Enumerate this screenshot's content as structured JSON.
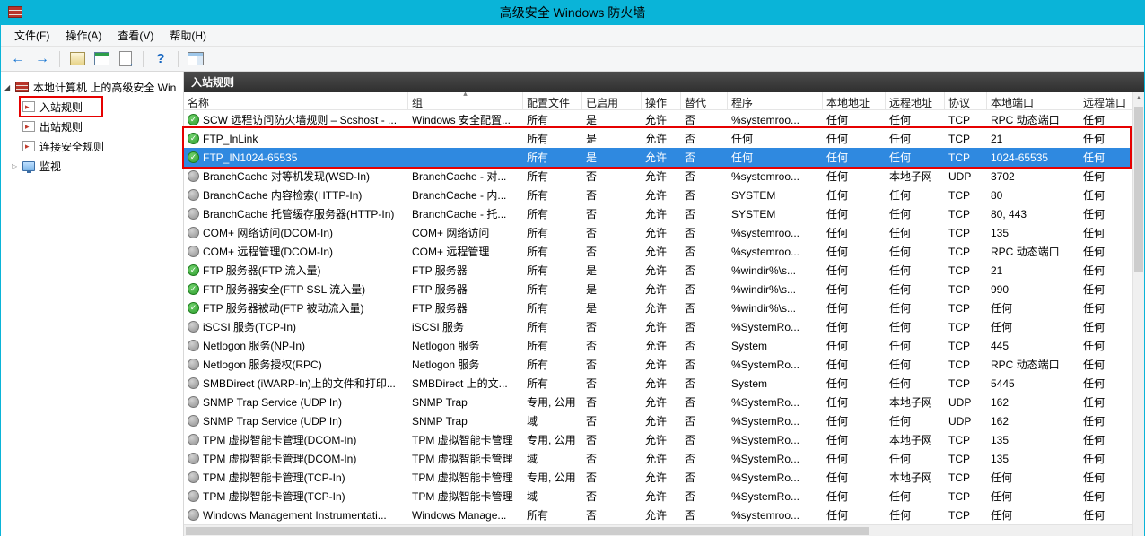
{
  "colors": {
    "titlebar": "#0ab4d8",
    "selection": "#2f89e0",
    "annotation": "#e60000",
    "panel_header_bg": "#3a3a3a",
    "enabled_icon": "#2e9e2e",
    "disabled_icon": "#8f8f8f"
  },
  "window": {
    "title": "高级安全 Windows 防火墙",
    "app_icon": "firewall-icon"
  },
  "menu": {
    "items": [
      {
        "id": "file",
        "label": "文件(F)"
      },
      {
        "id": "action",
        "label": "操作(A)"
      },
      {
        "id": "view",
        "label": "查看(V)"
      },
      {
        "id": "help",
        "label": "帮助(H)"
      }
    ]
  },
  "toolbar": {
    "icons": [
      "back-icon",
      "forward-icon",
      "show-console-tree-icon",
      "console-window-icon",
      "export-list-icon",
      "help-icon",
      "action-pane-icon"
    ]
  },
  "sidebar": {
    "root": {
      "label": "本地计算机 上的高级安全 Win",
      "icon": "firewall-root-icon"
    },
    "items": [
      {
        "id": "inbound-rules",
        "label": "入站规则",
        "icon": "inbound-rules-icon",
        "annotated": true
      },
      {
        "id": "outbound-rules",
        "label": "出站规则",
        "icon": "outbound-rules-icon"
      },
      {
        "id": "connection-security-rules",
        "label": "连接安全规则",
        "icon": "connection-security-icon"
      },
      {
        "id": "monitoring",
        "label": "监视",
        "icon": "monitoring-icon",
        "expander": true
      }
    ]
  },
  "panel": {
    "title": "入站规则"
  },
  "table": {
    "columns": [
      "名称",
      "组",
      "配置文件",
      "已启用",
      "操作",
      "替代",
      "程序",
      "本地地址",
      "远程地址",
      "协议",
      "本地端口",
      "远程端口"
    ],
    "sorted_column": "组",
    "rows": [
      {
        "icon": "enabled",
        "name": "SCW 远程访问防火墙规则 – Scshost - ...",
        "group": "Windows 安全配置...",
        "profile": "所有",
        "enabled": "是",
        "action": "允许",
        "override": "否",
        "program": "%systemroo...",
        "local_address": "任何",
        "remote_address": "任何",
        "protocol": "TCP",
        "local_port": "RPC 动态端口",
        "remote_port": "任何"
      },
      {
        "icon": "enabled",
        "name": "FTP_InLink",
        "group": "",
        "profile": "所有",
        "enabled": "是",
        "action": "允许",
        "override": "否",
        "program": "任何",
        "local_address": "任何",
        "remote_address": "任何",
        "protocol": "TCP",
        "local_port": "21",
        "remote_port": "任何"
      },
      {
        "icon": "enabled",
        "name": "FTP_IN1024-65535",
        "group": "",
        "profile": "所有",
        "enabled": "是",
        "action": "允许",
        "override": "否",
        "program": "任何",
        "local_address": "任何",
        "remote_address": "任何",
        "protocol": "TCP",
        "local_port": "1024-65535",
        "remote_port": "任何",
        "selected": true
      },
      {
        "icon": "disabled",
        "name": "BranchCache 对等机发现(WSD-In)",
        "group": "BranchCache - 对...",
        "profile": "所有",
        "enabled": "否",
        "action": "允许",
        "override": "否",
        "program": "%systemroo...",
        "local_address": "任何",
        "remote_address": "本地子网",
        "protocol": "UDP",
        "local_port": "3702",
        "remote_port": "任何"
      },
      {
        "icon": "disabled",
        "name": "BranchCache 内容检索(HTTP-In)",
        "group": "BranchCache - 内...",
        "profile": "所有",
        "enabled": "否",
        "action": "允许",
        "override": "否",
        "program": "SYSTEM",
        "local_address": "任何",
        "remote_address": "任何",
        "protocol": "TCP",
        "local_port": "80",
        "remote_port": "任何"
      },
      {
        "icon": "disabled",
        "name": "BranchCache 托管缓存服务器(HTTP-In)",
        "group": "BranchCache - 托...",
        "profile": "所有",
        "enabled": "否",
        "action": "允许",
        "override": "否",
        "program": "SYSTEM",
        "local_address": "任何",
        "remote_address": "任何",
        "protocol": "TCP",
        "local_port": "80, 443",
        "remote_port": "任何"
      },
      {
        "icon": "disabled",
        "name": "COM+ 网络访问(DCOM-In)",
        "group": "COM+ 网络访问",
        "profile": "所有",
        "enabled": "否",
        "action": "允许",
        "override": "否",
        "program": "%systemroo...",
        "local_address": "任何",
        "remote_address": "任何",
        "protocol": "TCP",
        "local_port": "135",
        "remote_port": "任何"
      },
      {
        "icon": "disabled",
        "name": "COM+ 远程管理(DCOM-In)",
        "group": "COM+ 远程管理",
        "profile": "所有",
        "enabled": "否",
        "action": "允许",
        "override": "否",
        "program": "%systemroo...",
        "local_address": "任何",
        "remote_address": "任何",
        "protocol": "TCP",
        "local_port": "RPC 动态端口",
        "remote_port": "任何"
      },
      {
        "icon": "enabled",
        "name": "FTP 服务器(FTP 流入量)",
        "group": "FTP 服务器",
        "profile": "所有",
        "enabled": "是",
        "action": "允许",
        "override": "否",
        "program": "%windir%\\s...",
        "local_address": "任何",
        "remote_address": "任何",
        "protocol": "TCP",
        "local_port": "21",
        "remote_port": "任何"
      },
      {
        "icon": "enabled",
        "name": "FTP 服务器安全(FTP SSL 流入量)",
        "group": "FTP 服务器",
        "profile": "所有",
        "enabled": "是",
        "action": "允许",
        "override": "否",
        "program": "%windir%\\s...",
        "local_address": "任何",
        "remote_address": "任何",
        "protocol": "TCP",
        "local_port": "990",
        "remote_port": "任何"
      },
      {
        "icon": "enabled",
        "name": "FTP 服务器被动(FTP 被动流入量)",
        "group": "FTP 服务器",
        "profile": "所有",
        "enabled": "是",
        "action": "允许",
        "override": "否",
        "program": "%windir%\\s...",
        "local_address": "任何",
        "remote_address": "任何",
        "protocol": "TCP",
        "local_port": "任何",
        "remote_port": "任何"
      },
      {
        "icon": "disabled",
        "name": "iSCSI 服务(TCP-In)",
        "group": "iSCSI 服务",
        "profile": "所有",
        "enabled": "否",
        "action": "允许",
        "override": "否",
        "program": "%SystemRo...",
        "local_address": "任何",
        "remote_address": "任何",
        "protocol": "TCP",
        "local_port": "任何",
        "remote_port": "任何"
      },
      {
        "icon": "disabled",
        "name": "Netlogon 服务(NP-In)",
        "group": "Netlogon 服务",
        "profile": "所有",
        "enabled": "否",
        "action": "允许",
        "override": "否",
        "program": "System",
        "local_address": "任何",
        "remote_address": "任何",
        "protocol": "TCP",
        "local_port": "445",
        "remote_port": "任何"
      },
      {
        "icon": "disabled",
        "name": "Netlogon 服务授权(RPC)",
        "group": "Netlogon 服务",
        "profile": "所有",
        "enabled": "否",
        "action": "允许",
        "override": "否",
        "program": "%SystemRo...",
        "local_address": "任何",
        "remote_address": "任何",
        "protocol": "TCP",
        "local_port": "RPC 动态端口",
        "remote_port": "任何"
      },
      {
        "icon": "disabled",
        "name": "SMBDirect (iWARP-In)上的文件和打印...",
        "group": "SMBDirect 上的文...",
        "profile": "所有",
        "enabled": "否",
        "action": "允许",
        "override": "否",
        "program": "System",
        "local_address": "任何",
        "remote_address": "任何",
        "protocol": "TCP",
        "local_port": "5445",
        "remote_port": "任何"
      },
      {
        "icon": "disabled",
        "name": "SNMP Trap Service (UDP In)",
        "group": "SNMP Trap",
        "profile": "专用, 公用",
        "enabled": "否",
        "action": "允许",
        "override": "否",
        "program": "%SystemRo...",
        "local_address": "任何",
        "remote_address": "本地子网",
        "protocol": "UDP",
        "local_port": "162",
        "remote_port": "任何"
      },
      {
        "icon": "disabled",
        "name": "SNMP Trap Service (UDP In)",
        "group": "SNMP Trap",
        "profile": "域",
        "enabled": "否",
        "action": "允许",
        "override": "否",
        "program": "%SystemRo...",
        "local_address": "任何",
        "remote_address": "任何",
        "protocol": "UDP",
        "local_port": "162",
        "remote_port": "任何"
      },
      {
        "icon": "disabled",
        "name": "TPM 虚拟智能卡管理(DCOM-In)",
        "group": "TPM 虚拟智能卡管理",
        "profile": "专用, 公用",
        "enabled": "否",
        "action": "允许",
        "override": "否",
        "program": "%SystemRo...",
        "local_address": "任何",
        "remote_address": "本地子网",
        "protocol": "TCP",
        "local_port": "135",
        "remote_port": "任何"
      },
      {
        "icon": "disabled",
        "name": "TPM 虚拟智能卡管理(DCOM-In)",
        "group": "TPM 虚拟智能卡管理",
        "profile": "域",
        "enabled": "否",
        "action": "允许",
        "override": "否",
        "program": "%SystemRo...",
        "local_address": "任何",
        "remote_address": "任何",
        "protocol": "TCP",
        "local_port": "135",
        "remote_port": "任何"
      },
      {
        "icon": "disabled",
        "name": "TPM 虚拟智能卡管理(TCP-In)",
        "group": "TPM 虚拟智能卡管理",
        "profile": "专用, 公用",
        "enabled": "否",
        "action": "允许",
        "override": "否",
        "program": "%SystemRo...",
        "local_address": "任何",
        "remote_address": "本地子网",
        "protocol": "TCP",
        "local_port": "任何",
        "remote_port": "任何"
      },
      {
        "icon": "disabled",
        "name": "TPM 虚拟智能卡管理(TCP-In)",
        "group": "TPM 虚拟智能卡管理",
        "profile": "域",
        "enabled": "否",
        "action": "允许",
        "override": "否",
        "program": "%SystemRo...",
        "local_address": "任何",
        "remote_address": "任何",
        "protocol": "TCP",
        "local_port": "任何",
        "remote_port": "任何"
      },
      {
        "icon": "disabled",
        "name": "Windows Management Instrumentati...",
        "group": "Windows Manage...",
        "profile": "所有",
        "enabled": "否",
        "action": "允许",
        "override": "否",
        "program": "%systemroo...",
        "local_address": "任何",
        "remote_address": "任何",
        "protocol": "TCP",
        "local_port": "任何",
        "remote_port": "任何"
      }
    ]
  }
}
